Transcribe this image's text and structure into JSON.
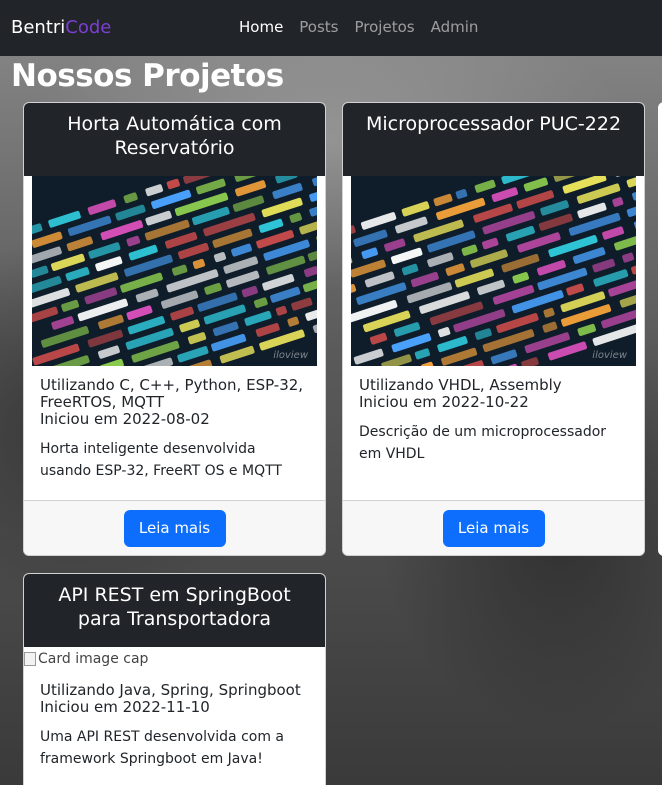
{
  "navbar": {
    "brand_part1": "Bentri",
    "brand_part2": "Code",
    "brand_accent_color": "#7b3fd0",
    "links": [
      {
        "label": "Home",
        "active": true
      },
      {
        "label": "Posts",
        "active": false
      },
      {
        "label": "Projetos",
        "active": false
      },
      {
        "label": "Admin",
        "active": false
      }
    ]
  },
  "page": {
    "title": "Nossos Projetos"
  },
  "projects": [
    {
      "title": "Horta Automática com Reservatório",
      "image": "code-screen-photo",
      "image_watermark": "iloview",
      "technologies": "Utilizando C, C++, Python, ESP-32, FreeRTOS, MQTT",
      "started": "Iniciou em 2022-08-02",
      "description": "Horta inteligente desenvolvida usando ESP-32, FreeRT OS e MQTT",
      "button_label": "Leia mais"
    },
    {
      "title": "Microprocessador PUC-222",
      "image": "code-screen-photo",
      "image_watermark": "iloview",
      "technologies": "Utilizando VHDL, Assembly",
      "started": "Iniciou em 2022-10-22",
      "description": "Descrição de um microprocessador em VHDL",
      "button_label": "Leia mais"
    },
    {
      "title": "API REST em SpringBoot para Transportadora",
      "image_alt": "Card image cap",
      "technologies": "Utilizando Java, Spring, Springboot",
      "started": "Iniciou em 2022-11-10",
      "description": "Uma API REST desenvolvida com a framework Springboot em Java!"
    }
  ],
  "colors": {
    "navbar_bg": "#212529",
    "card_header_bg": "#212529",
    "button_primary": "#0d6efd"
  }
}
